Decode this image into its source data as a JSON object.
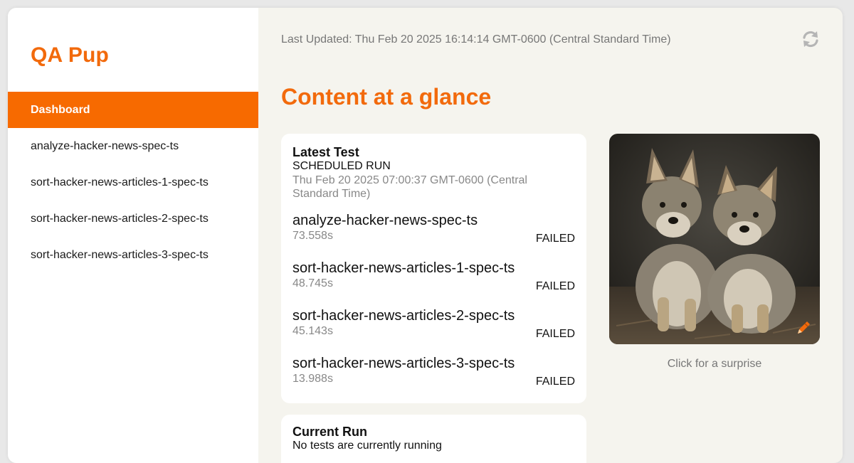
{
  "app": {
    "title": "QA Pup"
  },
  "sidebar": {
    "items": [
      {
        "label": "Dashboard",
        "active": true
      },
      {
        "label": "analyze-hacker-news-spec-ts",
        "active": false
      },
      {
        "label": "sort-hacker-news-articles-1-spec-ts",
        "active": false
      },
      {
        "label": "sort-hacker-news-articles-2-spec-ts",
        "active": false
      },
      {
        "label": "sort-hacker-news-articles-3-spec-ts",
        "active": false
      }
    ]
  },
  "header": {
    "last_updated": "Last Updated: Thu Feb 20 2025 16:14:14 GMT-0600 (Central Standard Time)",
    "refresh_icon": "refresh-icon"
  },
  "main": {
    "title": "Content at a glance",
    "latest_test": {
      "title": "Latest Test",
      "run_type": "SCHEDULED RUN",
      "timestamp": "Thu Feb 20 2025 07:00:37 GMT-0600 (Central Standard Time)",
      "tests": [
        {
          "name": "analyze-hacker-news-spec-ts",
          "duration": "73.558s",
          "status": "FAILED"
        },
        {
          "name": "sort-hacker-news-articles-1-spec-ts",
          "duration": "48.745s",
          "status": "FAILED"
        },
        {
          "name": "sort-hacker-news-articles-2-spec-ts",
          "duration": "45.143s",
          "status": "FAILED"
        },
        {
          "name": "sort-hacker-news-articles-3-spec-ts",
          "duration": "13.988s",
          "status": "FAILED"
        }
      ]
    },
    "current_run": {
      "title": "Current Run",
      "status_text": "No tests are currently running"
    },
    "pup": {
      "caption": "Click for a surprise",
      "edit_icon": "pencil-icon"
    }
  },
  "colors": {
    "accent": "#f76a00",
    "brand": "#f26a0c",
    "background": "#f5f4ee"
  }
}
